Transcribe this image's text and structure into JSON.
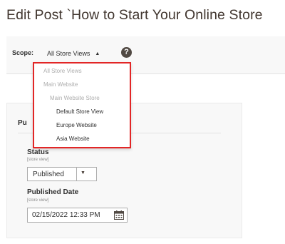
{
  "page": {
    "title": "Edit Post `How to Start Your Online Store"
  },
  "scope": {
    "label": "Scope:",
    "selected": "All Store Views",
    "help_icon_glyph": "?",
    "arrow_glyph": "▲"
  },
  "scope_dropdown": {
    "highlight_color": "#e22626",
    "items": [
      {
        "label": "All Store Views",
        "enabled": false
      },
      {
        "label": "Main Website",
        "enabled": false
      },
      {
        "label": "Main Website Store",
        "enabled": false
      },
      {
        "label": "Default Store View",
        "enabled": true
      },
      {
        "label": "Europe Website",
        "enabled": true
      },
      {
        "label": "Asia Website",
        "enabled": true
      }
    ]
  },
  "form": {
    "section_title_partial": "Pu",
    "status": {
      "label": "Status",
      "scope_note": "[store view]",
      "value": "Published",
      "arrow_glyph": "▼"
    },
    "published_date": {
      "label": "Published Date",
      "scope_note": "[store view]",
      "value": "02/15/2022 12:33 PM"
    }
  }
}
